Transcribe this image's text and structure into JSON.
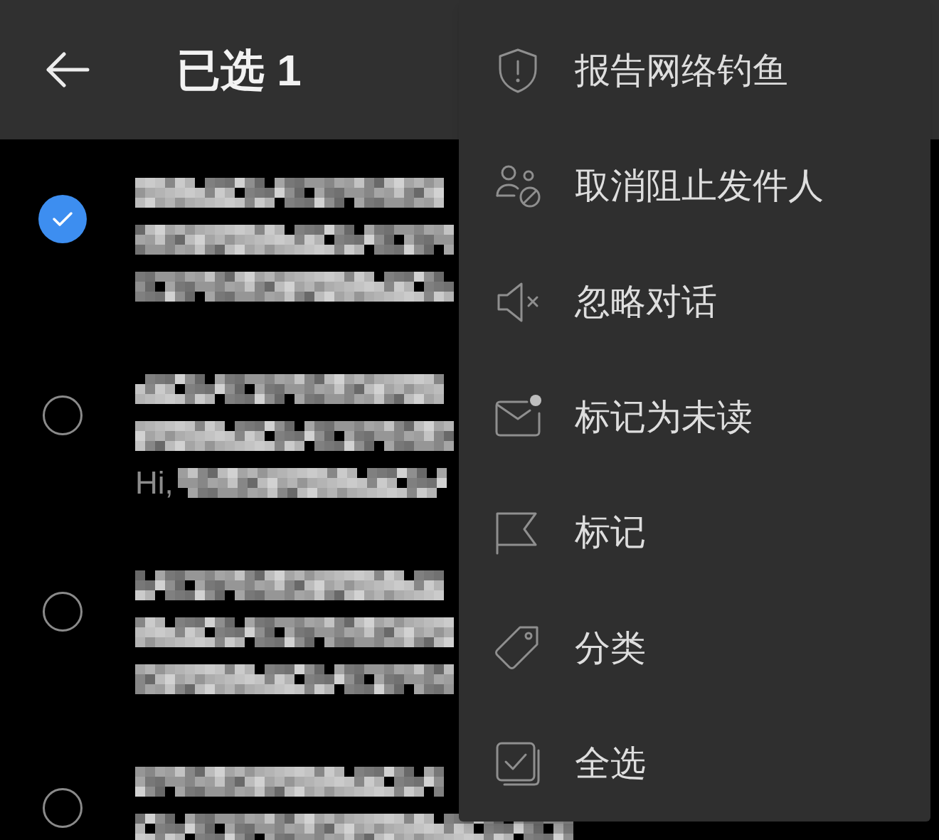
{
  "header": {
    "title": "已选 1"
  },
  "messages": [
    {
      "selected": true
    },
    {
      "selected": false,
      "preview_start": "Hi,"
    },
    {
      "selected": false
    },
    {
      "selected": false
    }
  ],
  "menu": [
    {
      "kind": "shield",
      "label": "报告网络钓鱼"
    },
    {
      "kind": "unblock",
      "label": "取消阻止发件人"
    },
    {
      "kind": "mute",
      "label": "忽略对话"
    },
    {
      "kind": "unread",
      "label": "标记为未读"
    },
    {
      "kind": "flag",
      "label": "标记"
    },
    {
      "kind": "tag",
      "label": "分类"
    },
    {
      "kind": "selectall",
      "label": "全选"
    }
  ]
}
